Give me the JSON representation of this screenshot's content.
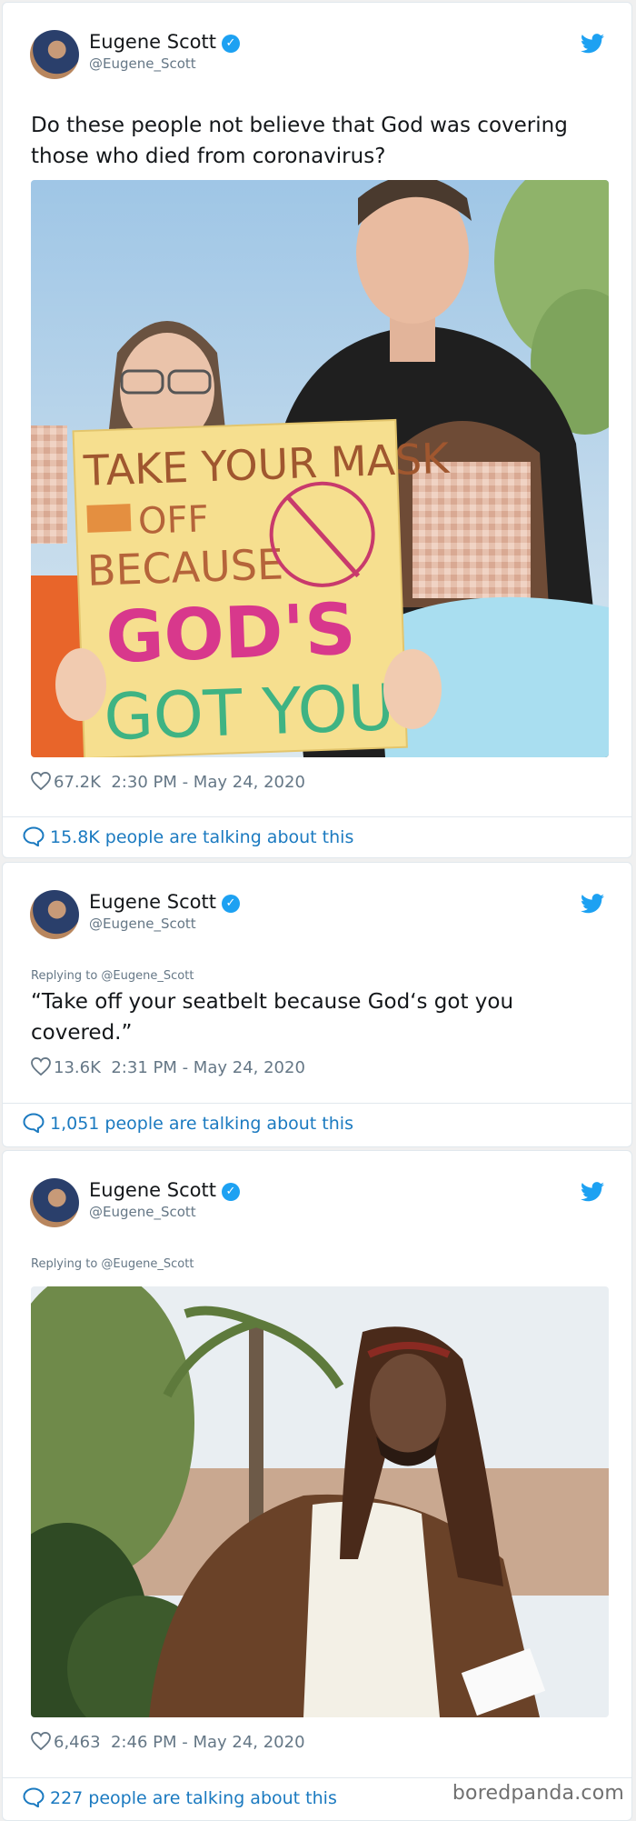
{
  "tweets": [
    {
      "name": "Eugene Scott",
      "handle": "@Eugene_Scott",
      "text": "Do these people not believe that God was covering those who died from coronavirus?",
      "likes": "67.2K",
      "timestamp": "2:30 PM - May 24, 2020",
      "talking": "15.8K people are talking about this",
      "sign_lines": [
        "TAKE YOUR MASK",
        "OFF",
        "BECAUSE",
        "GOD'S",
        "GOT YOU"
      ]
    },
    {
      "name": "Eugene Scott",
      "handle": "@Eugene_Scott",
      "replying": "Replying to @Eugene_Scott",
      "text": "“Take off your seatbelt because God‘s got you covered.”",
      "likes": "13.6K",
      "timestamp": "2:31 PM - May 24, 2020",
      "talking": "1,051 people are talking about this"
    },
    {
      "name": "Eugene Scott",
      "handle": "@Eugene_Scott",
      "replying": "Replying to @Eugene_Scott",
      "likes": "6,463",
      "timestamp": "2:46 PM - May 24, 2020",
      "talking": "227 people are talking about this"
    }
  ],
  "watermark": "boredpanda.com",
  "colors": {
    "link": "#1b7ac0",
    "twitter_blue": "#1da1f2",
    "muted": "#657786"
  },
  "icons": [
    "verified-badge-icon",
    "twitter-bird-icon",
    "heart-icon",
    "speech-bubble-icon"
  ]
}
